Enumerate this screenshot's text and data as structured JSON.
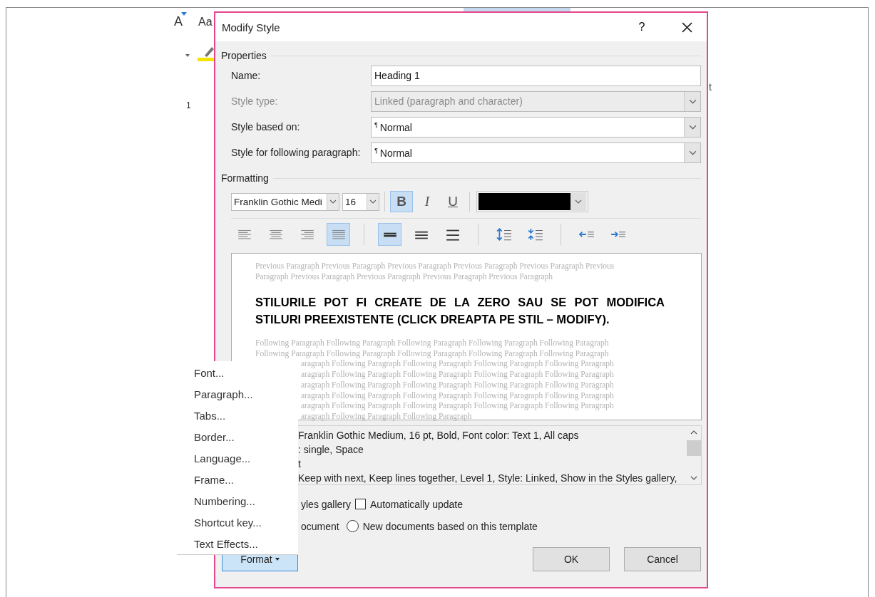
{
  "background_document": {
    "ribbon_texts": [
      "A",
      "Aa"
    ],
    "ruler_number": "1",
    "edge_text": "t"
  },
  "dialog": {
    "title": "Modify Style",
    "help_button": "?",
    "properties": {
      "heading": "Properties",
      "fields": [
        {
          "label": "Name:",
          "kind": "text",
          "value": "Heading 1",
          "disabled": false
        },
        {
          "label": "Style type:",
          "kind": "dropdown",
          "value": "Linked (paragraph and character)",
          "disabled": true
        },
        {
          "label": "Style based on:",
          "kind": "dropdown",
          "mark": "¶",
          "value": "Normal",
          "disabled": false
        },
        {
          "label": "Style for following paragraph:",
          "kind": "dropdown",
          "mark": "¶",
          "value": "Normal",
          "disabled": false
        }
      ]
    },
    "formatting": {
      "heading": "Formatting",
      "font": "Franklin Gothic Medi",
      "size": "16",
      "styles": [
        {
          "label": "B",
          "kind": "bold",
          "selected": true
        },
        {
          "label": "I",
          "kind": "italic",
          "selected": false
        },
        {
          "label": "U",
          "kind": "underline",
          "selected": false
        }
      ],
      "paragraph_buttons": [
        {
          "kind": "align-left",
          "selected": false
        },
        {
          "kind": "align-center",
          "selected": false
        },
        {
          "kind": "align-right",
          "selected": false
        },
        {
          "kind": "justify",
          "selected": true
        },
        {
          "kind": "spacing-single",
          "selected": true
        },
        {
          "kind": "spacing-one-half",
          "selected": false
        },
        {
          "kind": "spacing-double",
          "selected": false
        },
        {
          "kind": "space-increase",
          "selected": false
        },
        {
          "kind": "space-decrease",
          "selected": false
        },
        {
          "kind": "indent-decrease",
          "selected": false
        },
        {
          "kind": "indent-increase",
          "selected": false
        }
      ]
    },
    "preview": {
      "previous": "Previous Paragraph Previous Paragraph Previous Paragraph Previous Paragraph Previous Paragraph Previous Paragraph Previous Paragraph Previous Paragraph Previous Paragraph Previous Paragraph",
      "heading": "STILURILE POT FI CREATE DE LA ZERO SAU SE POT MODIFICA STILURI PREEXISTENTE (CLICK DREAPTA PE STIL – MODIFY).",
      "following_lines": [
        {
          "text": "Following Paragraph Following Paragraph Following Paragraph Following Paragraph Following Paragraph",
          "kind": "full"
        },
        {
          "text": "Following Paragraph Following Paragraph Following Paragraph Following Paragraph Following Paragraph",
          "kind": "full"
        },
        {
          "text": "aragraph Following Paragraph Following Paragraph Following Paragraph Following Paragraph",
          "kind": "covered"
        },
        {
          "text": "aragraph Following Paragraph Following Paragraph Following Paragraph Following Paragraph",
          "kind": "covered"
        },
        {
          "text": "aragraph Following Paragraph Following Paragraph Following Paragraph Following Paragraph",
          "kind": "covered"
        },
        {
          "text": "aragraph Following Paragraph Following Paragraph Following Paragraph Following Paragraph",
          "kind": "covered"
        },
        {
          "text": "aragraph Following Paragraph Following Paragraph Following Paragraph Following Paragraph",
          "kind": "covered"
        },
        {
          "text": "aragraph Following Paragraph Following Paragraph",
          "kind": "covered"
        }
      ]
    },
    "description": [
      "Franklin Gothic Medium, 16 pt, Bold, Font color: Text 1, All caps",
      ":  single, Space",
      "t",
      "Keep with next, Keep lines together, Level 1, Style: Linked, Show in the Styles gallery,"
    ],
    "options": [
      {
        "partial_text": "yles gallery",
        "kind": "checkbox",
        "label": "Automatically update",
        "checked": false
      },
      {
        "partial_text": "ocument",
        "kind": "radio",
        "label": "New documents based on this template",
        "checked": false
      }
    ],
    "format_button": "Format",
    "ok_button": "OK",
    "cancel_button": "Cancel"
  },
  "format_menu": [
    "Font...",
    "Paragraph...",
    "Tabs...",
    "Border...",
    "Language...",
    "Frame...",
    "Numbering...",
    "Shortcut key...",
    "Text Effects..."
  ]
}
